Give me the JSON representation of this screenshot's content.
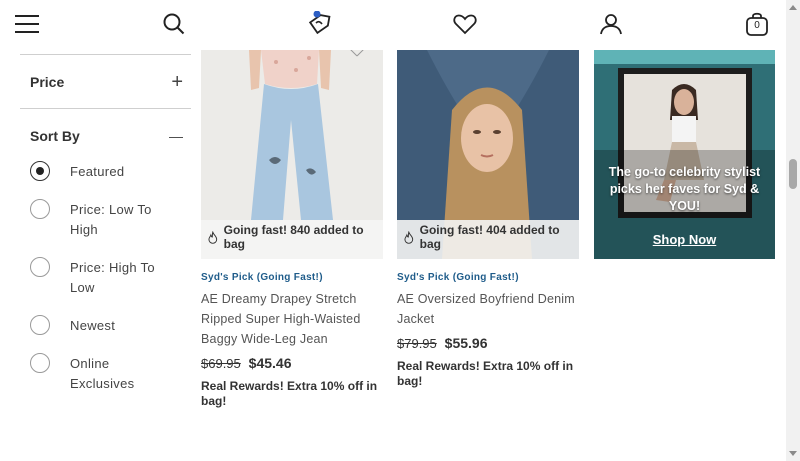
{
  "nav": {
    "icons": [
      "menu-icon",
      "search-icon",
      "rewards-tag-icon",
      "heart-icon",
      "account-icon",
      "bag-icon"
    ],
    "bag_count": "0",
    "accent": "#2c5ec4"
  },
  "sidebar": {
    "price_label": "Price",
    "price_toggle": "+",
    "sort_label": "Sort By",
    "sort_toggle": "—",
    "sort_options": [
      {
        "label": "Featured",
        "selected": true
      },
      {
        "label": "Price: Low To High",
        "selected": false
      },
      {
        "label": "Price: High To Low",
        "selected": false
      },
      {
        "label": "Newest",
        "selected": false
      },
      {
        "label": "Online Exclusives",
        "selected": false
      }
    ]
  },
  "products": [
    {
      "badge": "Going fast! 840 added to bag",
      "tag": "Syd's Pick (Going Fast!)",
      "name": "AE Dreamy Drapey Stretch Ripped Super High-Waisted Baggy Wide-Leg Jean",
      "old_price": "$69.95",
      "price": "$45.46",
      "promo": "Real Rewards! Extra 10% off in bag!"
    },
    {
      "badge": "Going fast! 404 added to bag",
      "tag": "Syd's Pick (Going Fast!)",
      "name": "AE Oversized Boyfriend Denim Jacket",
      "old_price": "$79.95",
      "price": "$55.96",
      "promo": "Real Rewards! Extra 10% off in bag!"
    }
  ],
  "promo_tile": {
    "headline": "The go-to celebrity stylist picks her faves for Syd & YOU!",
    "link": "Shop Now",
    "background": "#2f6f76"
  },
  "colors": {
    "tag_blue": "#1f5c8a",
    "text": "#333333"
  }
}
